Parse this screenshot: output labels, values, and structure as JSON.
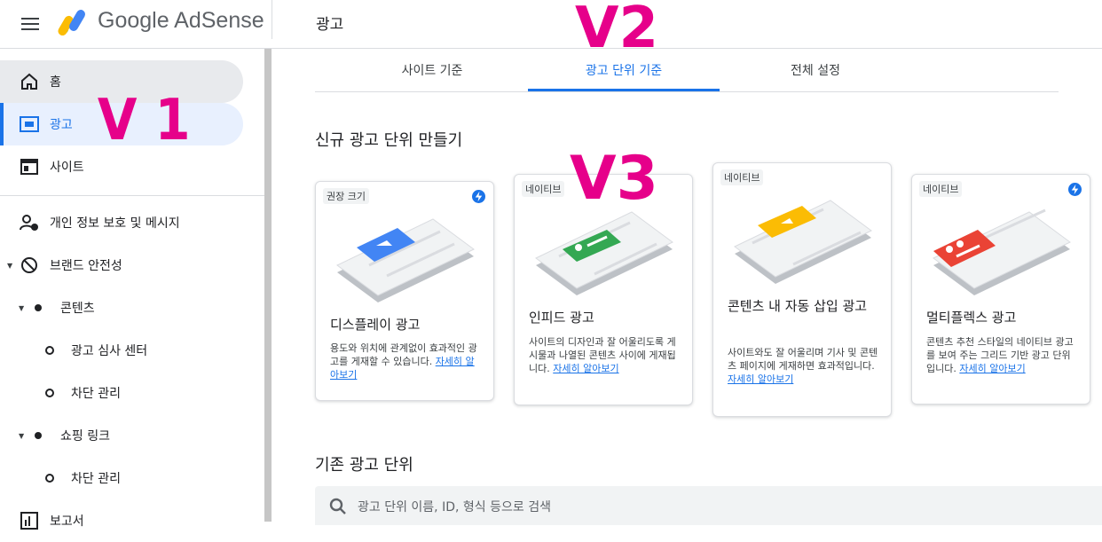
{
  "app": {
    "brand": "Google AdSense",
    "page_title": "광고"
  },
  "sidebar": {
    "items": [
      {
        "label": "홈",
        "icon": "home-icon"
      },
      {
        "label": "광고",
        "icon": "ads-icon"
      },
      {
        "label": "사이트",
        "icon": "sites-icon"
      },
      {
        "label": "개인 정보 보호 및 메시지",
        "icon": "privacy-icon"
      },
      {
        "label": "브랜드 안전성",
        "icon": "block-icon"
      },
      {
        "label": "콘텐츠",
        "icon": "dot-icon"
      },
      {
        "label": "광고 심사 센터",
        "icon": "circle-icon"
      },
      {
        "label": "차단 관리",
        "icon": "circle-icon"
      },
      {
        "label": "쇼핑 링크",
        "icon": "dot-icon"
      },
      {
        "label": "차단 관리",
        "icon": "circle-icon"
      },
      {
        "label": "보고서",
        "icon": "report-icon"
      }
    ]
  },
  "tabs": [
    {
      "label": "사이트 기준"
    },
    {
      "label": "광고 단위 기준",
      "active": true
    },
    {
      "label": "전체 설정"
    }
  ],
  "new_section": {
    "title": "신규 광고 단위 만들기"
  },
  "cards": [
    {
      "tag": "권장 크기",
      "title": "디스플레이 광고",
      "desc": "용도와 위치에 관계없이 효과적인 광고를 게재할 수 있습니다.",
      "link": "자세히 알아보기",
      "color": "#4285f4"
    },
    {
      "tag": "네이티브",
      "title": "인피드 광고",
      "desc": "사이트의 디자인과 잘 어울리도록 게시물과 나열된 콘텐츠 사이에 게재됩니다.",
      "link": "자세히 알아보기",
      "color": "#34a853"
    },
    {
      "tag": "네이티브",
      "title": "콘텐츠 내 자동 삽입 광고",
      "desc": "사이트와도 잘 어울리며 기사 및 콘텐츠 페이지에 게재하면 효과적입니다.",
      "link": "자세히 알아보기",
      "color": "#fbbc04"
    },
    {
      "tag": "네이티브",
      "title": "멀티플렉스 광고",
      "desc": "콘텐츠 추천 스타일의 네이티브 광고를 보여 주는 그리드 기반 광고 단위입니다.",
      "link": "자세히 알아보기",
      "color": "#ea4335"
    }
  ],
  "existing_section": {
    "title": "기존 광고 단위"
  },
  "search": {
    "placeholder": "광고 단위 이름, ID, 형식 등으로 검색"
  },
  "annotations": {
    "v1": "V 1",
    "v2": "V2",
    "v3": "V3"
  },
  "colors": {
    "accent": "#1a73e8",
    "annotation": "#e6008a"
  }
}
